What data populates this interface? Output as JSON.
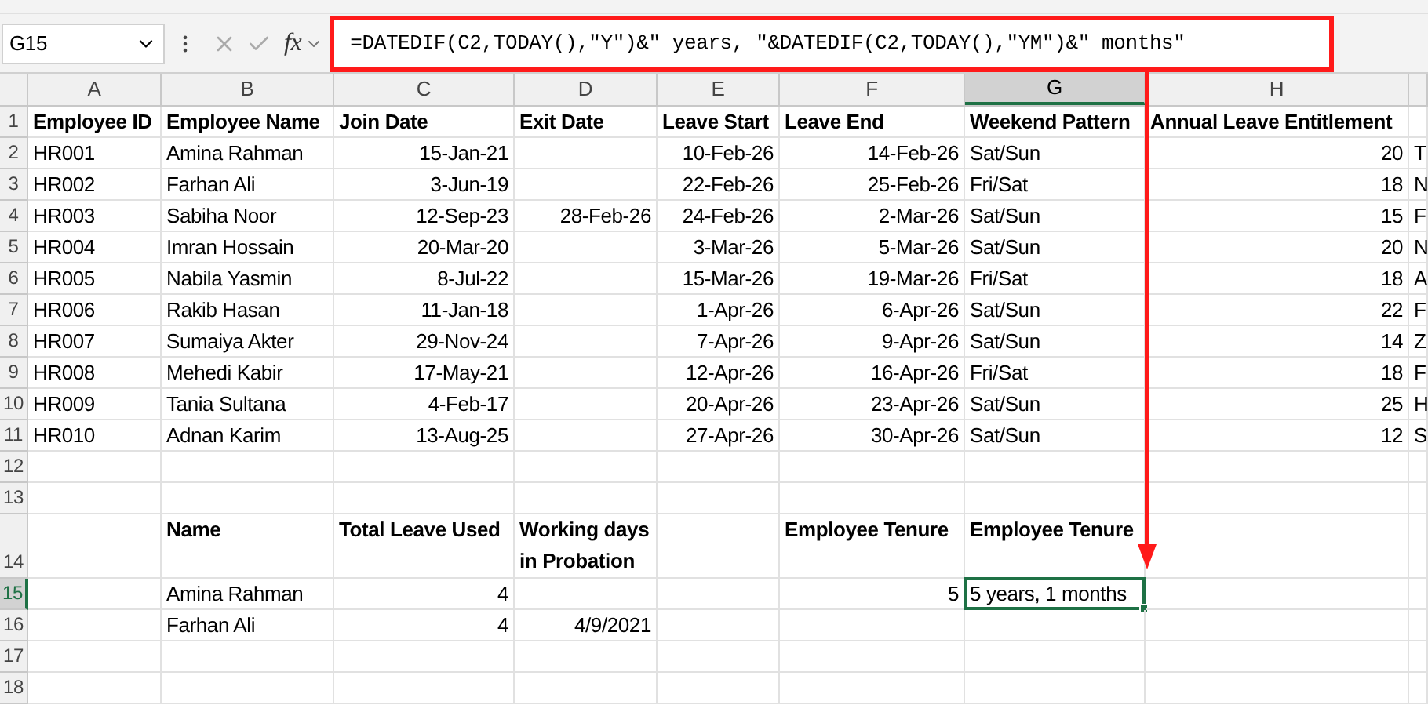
{
  "name_box": "G15",
  "formula_bar": {
    "function_label": "fx",
    "formula": "=DATEDIF(C2,TODAY(),\"Y\")&\" years, \"&DATEDIF(C2,TODAY(),\"YM\")&\" months\""
  },
  "columns": [
    {
      "label": "A",
      "selected": false
    },
    {
      "label": "B",
      "selected": false
    },
    {
      "label": "C",
      "selected": false
    },
    {
      "label": "D",
      "selected": false
    },
    {
      "label": "E",
      "selected": false
    },
    {
      "label": "F",
      "selected": false
    },
    {
      "label": "G",
      "selected": true
    },
    {
      "label": "H",
      "selected": false
    }
  ],
  "rows": [
    {
      "number": "1",
      "selected": false,
      "kind": "header",
      "cells": [
        "Employee ID",
        "Employee Name",
        "Join Date",
        "Exit Date",
        "Leave Start",
        "Leave End",
        "Weekend Pattern",
        "Annual Leave Entitlement",
        null
      ]
    },
    {
      "number": "2",
      "selected": false,
      "kind": "data",
      "cells": [
        "HR001",
        "Amina Rahman",
        "15-Jan-21",
        null,
        "10-Feb-26",
        "14-Feb-26",
        "Sat/Sun",
        "20",
        "T"
      ]
    },
    {
      "number": "3",
      "selected": false,
      "kind": "data",
      "cells": [
        "HR002",
        "Farhan Ali",
        "3-Jun-19",
        null,
        "22-Feb-26",
        "25-Feb-26",
        "Fri/Sat",
        "18",
        "N"
      ]
    },
    {
      "number": "4",
      "selected": false,
      "kind": "data",
      "cells": [
        "HR003",
        "Sabiha Noor",
        "12-Sep-23",
        "28-Feb-26",
        "24-Feb-26",
        "2-Mar-26",
        "Sat/Sun",
        "15",
        "F"
      ]
    },
    {
      "number": "5",
      "selected": false,
      "kind": "data",
      "cells": [
        "HR004",
        "Imran Hossain",
        "20-Mar-20",
        null,
        "3-Mar-26",
        "5-Mar-26",
        "Sat/Sun",
        "20",
        "N"
      ]
    },
    {
      "number": "6",
      "selected": false,
      "kind": "data",
      "cells": [
        "HR005",
        "Nabila Yasmin",
        "8-Jul-22",
        null,
        "15-Mar-26",
        "19-Mar-26",
        "Fri/Sat",
        "18",
        "A"
      ]
    },
    {
      "number": "7",
      "selected": false,
      "kind": "data",
      "cells": [
        "HR006",
        "Rakib Hasan",
        "11-Jan-18",
        null,
        "1-Apr-26",
        "6-Apr-26",
        "Sat/Sun",
        "22",
        "F"
      ]
    },
    {
      "number": "8",
      "selected": false,
      "kind": "data",
      "cells": [
        "HR007",
        "Sumaiya Akter",
        "29-Nov-24",
        null,
        "7-Apr-26",
        "9-Apr-26",
        "Sat/Sun",
        "14",
        "Z"
      ]
    },
    {
      "number": "9",
      "selected": false,
      "kind": "data",
      "cells": [
        "HR008",
        "Mehedi Kabir",
        "17-May-21",
        null,
        "12-Apr-26",
        "16-Apr-26",
        "Fri/Sat",
        "18",
        "F"
      ]
    },
    {
      "number": "10",
      "selected": false,
      "kind": "data",
      "cells": [
        "HR009",
        "Tania Sultana",
        "4-Feb-17",
        null,
        "20-Apr-26",
        "23-Apr-26",
        "Sat/Sun",
        "25",
        "H"
      ]
    },
    {
      "number": "11",
      "selected": false,
      "kind": "data",
      "cells": [
        "HR010",
        "Adnan Karim",
        "13-Aug-25",
        null,
        "27-Apr-26",
        "30-Apr-26",
        "Sat/Sun",
        "12",
        "S"
      ]
    },
    {
      "number": "12",
      "selected": false,
      "kind": "data",
      "cells": []
    },
    {
      "number": "13",
      "selected": false,
      "kind": "data",
      "cells": []
    },
    {
      "number": "14",
      "selected": false,
      "kind": "wrapped_header",
      "cells": [
        null,
        "Name",
        "Total Leave Used",
        "Working days in Probation",
        null,
        "Employee Tenure",
        "Employee Tenure"
      ]
    },
    {
      "number": "15",
      "selected": true,
      "kind": "data",
      "cells": [
        null,
        "Amina Rahman",
        "4",
        null,
        null,
        "5",
        "5 years, 1 months"
      ]
    },
    {
      "number": "16",
      "selected": false,
      "kind": "data",
      "cells": [
        null,
        "Farhan Ali",
        "4",
        "4/9/2021"
      ]
    },
    {
      "number": "17",
      "selected": false,
      "kind": "data",
      "cells": []
    },
    {
      "number": "18",
      "selected": false,
      "kind": "data",
      "cells": []
    }
  ]
}
